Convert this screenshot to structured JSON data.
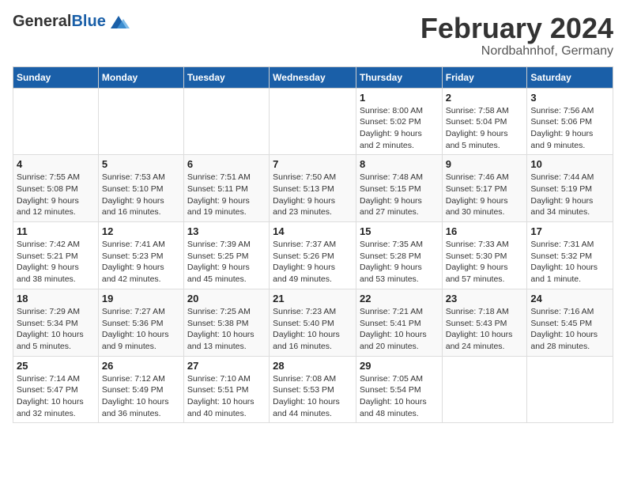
{
  "header": {
    "logo_general": "General",
    "logo_blue": "Blue",
    "month": "February 2024",
    "location": "Nordbahnhof, Germany"
  },
  "columns": [
    "Sunday",
    "Monday",
    "Tuesday",
    "Wednesday",
    "Thursday",
    "Friday",
    "Saturday"
  ],
  "weeks": [
    [
      {
        "day": "",
        "info": ""
      },
      {
        "day": "",
        "info": ""
      },
      {
        "day": "",
        "info": ""
      },
      {
        "day": "",
        "info": ""
      },
      {
        "day": "1",
        "info": "Sunrise: 8:00 AM\nSunset: 5:02 PM\nDaylight: 9 hours\nand 2 minutes."
      },
      {
        "day": "2",
        "info": "Sunrise: 7:58 AM\nSunset: 5:04 PM\nDaylight: 9 hours\nand 5 minutes."
      },
      {
        "day": "3",
        "info": "Sunrise: 7:56 AM\nSunset: 5:06 PM\nDaylight: 9 hours\nand 9 minutes."
      }
    ],
    [
      {
        "day": "4",
        "info": "Sunrise: 7:55 AM\nSunset: 5:08 PM\nDaylight: 9 hours\nand 12 minutes."
      },
      {
        "day": "5",
        "info": "Sunrise: 7:53 AM\nSunset: 5:10 PM\nDaylight: 9 hours\nand 16 minutes."
      },
      {
        "day": "6",
        "info": "Sunrise: 7:51 AM\nSunset: 5:11 PM\nDaylight: 9 hours\nand 19 minutes."
      },
      {
        "day": "7",
        "info": "Sunrise: 7:50 AM\nSunset: 5:13 PM\nDaylight: 9 hours\nand 23 minutes."
      },
      {
        "day": "8",
        "info": "Sunrise: 7:48 AM\nSunset: 5:15 PM\nDaylight: 9 hours\nand 27 minutes."
      },
      {
        "day": "9",
        "info": "Sunrise: 7:46 AM\nSunset: 5:17 PM\nDaylight: 9 hours\nand 30 minutes."
      },
      {
        "day": "10",
        "info": "Sunrise: 7:44 AM\nSunset: 5:19 PM\nDaylight: 9 hours\nand 34 minutes."
      }
    ],
    [
      {
        "day": "11",
        "info": "Sunrise: 7:42 AM\nSunset: 5:21 PM\nDaylight: 9 hours\nand 38 minutes."
      },
      {
        "day": "12",
        "info": "Sunrise: 7:41 AM\nSunset: 5:23 PM\nDaylight: 9 hours\nand 42 minutes."
      },
      {
        "day": "13",
        "info": "Sunrise: 7:39 AM\nSunset: 5:25 PM\nDaylight: 9 hours\nand 45 minutes."
      },
      {
        "day": "14",
        "info": "Sunrise: 7:37 AM\nSunset: 5:26 PM\nDaylight: 9 hours\nand 49 minutes."
      },
      {
        "day": "15",
        "info": "Sunrise: 7:35 AM\nSunset: 5:28 PM\nDaylight: 9 hours\nand 53 minutes."
      },
      {
        "day": "16",
        "info": "Sunrise: 7:33 AM\nSunset: 5:30 PM\nDaylight: 9 hours\nand 57 minutes."
      },
      {
        "day": "17",
        "info": "Sunrise: 7:31 AM\nSunset: 5:32 PM\nDaylight: 10 hours\nand 1 minute."
      }
    ],
    [
      {
        "day": "18",
        "info": "Sunrise: 7:29 AM\nSunset: 5:34 PM\nDaylight: 10 hours\nand 5 minutes."
      },
      {
        "day": "19",
        "info": "Sunrise: 7:27 AM\nSunset: 5:36 PM\nDaylight: 10 hours\nand 9 minutes."
      },
      {
        "day": "20",
        "info": "Sunrise: 7:25 AM\nSunset: 5:38 PM\nDaylight: 10 hours\nand 13 minutes."
      },
      {
        "day": "21",
        "info": "Sunrise: 7:23 AM\nSunset: 5:40 PM\nDaylight: 10 hours\nand 16 minutes."
      },
      {
        "day": "22",
        "info": "Sunrise: 7:21 AM\nSunset: 5:41 PM\nDaylight: 10 hours\nand 20 minutes."
      },
      {
        "day": "23",
        "info": "Sunrise: 7:18 AM\nSunset: 5:43 PM\nDaylight: 10 hours\nand 24 minutes."
      },
      {
        "day": "24",
        "info": "Sunrise: 7:16 AM\nSunset: 5:45 PM\nDaylight: 10 hours\nand 28 minutes."
      }
    ],
    [
      {
        "day": "25",
        "info": "Sunrise: 7:14 AM\nSunset: 5:47 PM\nDaylight: 10 hours\nand 32 minutes."
      },
      {
        "day": "26",
        "info": "Sunrise: 7:12 AM\nSunset: 5:49 PM\nDaylight: 10 hours\nand 36 minutes."
      },
      {
        "day": "27",
        "info": "Sunrise: 7:10 AM\nSunset: 5:51 PM\nDaylight: 10 hours\nand 40 minutes."
      },
      {
        "day": "28",
        "info": "Sunrise: 7:08 AM\nSunset: 5:53 PM\nDaylight: 10 hours\nand 44 minutes."
      },
      {
        "day": "29",
        "info": "Sunrise: 7:05 AM\nSunset: 5:54 PM\nDaylight: 10 hours\nand 48 minutes."
      },
      {
        "day": "",
        "info": ""
      },
      {
        "day": "",
        "info": ""
      }
    ]
  ]
}
